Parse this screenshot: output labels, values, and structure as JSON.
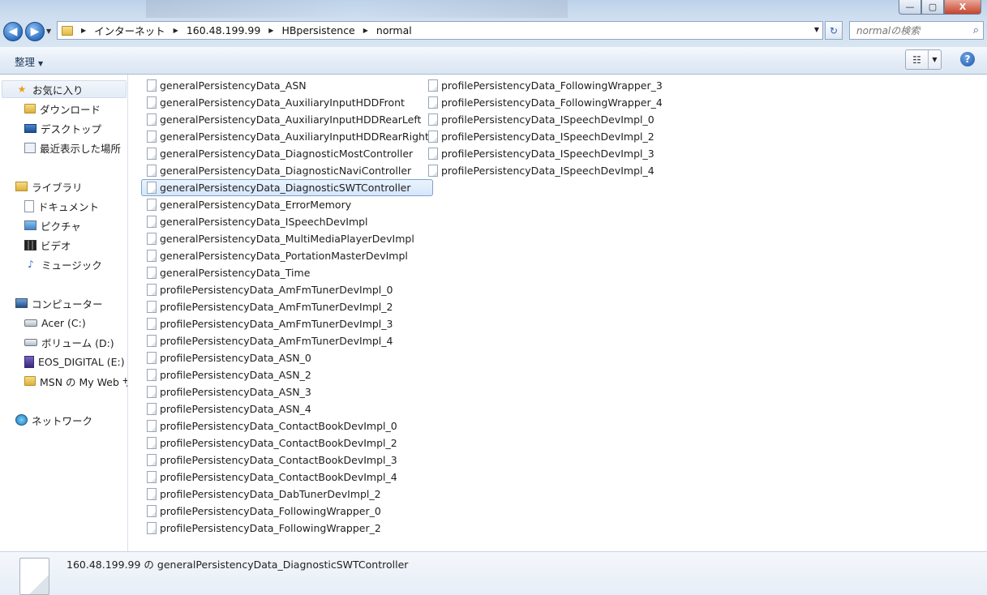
{
  "window": {
    "buttons": {
      "minimize": "—",
      "maximize": "▢",
      "close": "X"
    }
  },
  "address": {
    "crumbs": [
      "インターネット",
      "160.48.199.99",
      "HBpersistence",
      "normal"
    ]
  },
  "search": {
    "placeholder": "normalの検索"
  },
  "toolbar": {
    "organize_label": "整理"
  },
  "sidebar": {
    "favorites": {
      "label": "お気に入り",
      "items": [
        "ダウンロード",
        "デスクトップ",
        "最近表示した場所"
      ]
    },
    "libraries": {
      "label": "ライブラリ",
      "items": [
        "ドキュメント",
        "ピクチャ",
        "ビデオ",
        "ミュージック"
      ]
    },
    "computer": {
      "label": "コンピューター",
      "items": [
        "Acer (C:)",
        "ボリューム (D:)",
        "EOS_DIGITAL (E:)",
        "MSN の My Web サ"
      ]
    },
    "network": {
      "label": "ネットワーク"
    }
  },
  "files": {
    "column1": [
      "generalPersistencyData_ASN",
      "generalPersistencyData_AuxiliaryInputHDDFront",
      "generalPersistencyData_AuxiliaryInputHDDRearLeft",
      "generalPersistencyData_AuxiliaryInputHDDRearRight",
      "generalPersistencyData_DiagnosticMostController",
      "generalPersistencyData_DiagnosticNaviController",
      "generalPersistencyData_DiagnosticSWTController",
      "generalPersistencyData_ErrorMemory",
      "generalPersistencyData_ISpeechDevImpl",
      "generalPersistencyData_MultiMediaPlayerDevImpl",
      "generalPersistencyData_PortationMasterDevImpl",
      "generalPersistencyData_Time",
      "profilePersistencyData_AmFmTunerDevImpl_0",
      "profilePersistencyData_AmFmTunerDevImpl_2",
      "profilePersistencyData_AmFmTunerDevImpl_3",
      "profilePersistencyData_AmFmTunerDevImpl_4",
      "profilePersistencyData_ASN_0",
      "profilePersistencyData_ASN_2",
      "profilePersistencyData_ASN_3",
      "profilePersistencyData_ASN_4",
      "profilePersistencyData_ContactBookDevImpl_0",
      "profilePersistencyData_ContactBookDevImpl_2",
      "profilePersistencyData_ContactBookDevImpl_3",
      "profilePersistencyData_ContactBookDevImpl_4",
      "profilePersistencyData_DabTunerDevImpl_2",
      "profilePersistencyData_FollowingWrapper_0",
      "profilePersistencyData_FollowingWrapper_2"
    ],
    "column2": [
      "profilePersistencyData_FollowingWrapper_3",
      "profilePersistencyData_FollowingWrapper_4",
      "profilePersistencyData_ISpeechDevImpl_0",
      "profilePersistencyData_ISpeechDevImpl_2",
      "profilePersistencyData_ISpeechDevImpl_3",
      "profilePersistencyData_ISpeechDevImpl_4"
    ],
    "selected": "generalPersistencyData_DiagnosticSWTController"
  },
  "details": {
    "text": "160.48.199.99 の generalPersistencyData_DiagnosticSWTController"
  }
}
